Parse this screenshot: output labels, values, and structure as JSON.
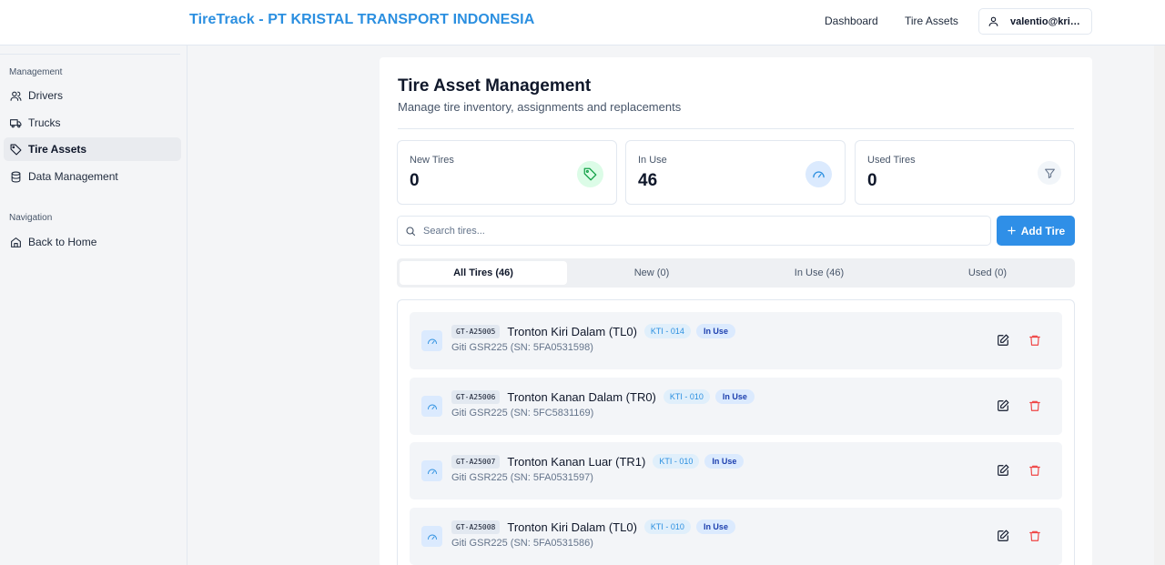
{
  "header": {
    "brand": "TireTrack - PT KRISTAL TRANSPORT INDONESIA",
    "nav": [
      "Dashboard",
      "Tire Assets"
    ],
    "user": "valentio@kris..."
  },
  "sidebar": {
    "management_title": "Management",
    "management_items": [
      "Drivers",
      "Trucks",
      "Tire Assets",
      "Data Management"
    ],
    "navigation_title": "Navigation",
    "navigation_items": [
      "Back to Home"
    ]
  },
  "page": {
    "title": "Tire Asset Management",
    "subtitle": "Manage tire inventory, assignments and replacements"
  },
  "stats": [
    {
      "label": "New Tires",
      "value": "0",
      "icon": "tag-icon",
      "color": "#16a34a"
    },
    {
      "label": "In Use",
      "value": "46",
      "icon": "gauge-icon",
      "color": "#2b8fe0"
    },
    {
      "label": "Used Tires",
      "value": "0",
      "icon": "filter-icon",
      "color": "#64748b"
    }
  ],
  "search": {
    "placeholder": "Search tires..."
  },
  "add_button": "Add Tire",
  "tabs": [
    "All Tires (46)",
    "New (0)",
    "In Use (46)",
    "Used (0)"
  ],
  "tires": [
    {
      "code": "GT-A25005",
      "position": "Tronton Kiri Dalam (TL0)",
      "truck": "KTI - 014",
      "status": "In Use",
      "detail": "Giti GSR225 (SN: 5FA0531598)"
    },
    {
      "code": "GT-A25006",
      "position": "Tronton Kanan Dalam (TR0)",
      "truck": "KTI - 010",
      "status": "In Use",
      "detail": "Giti GSR225 (SN: 5FC5831169)"
    },
    {
      "code": "GT-A25007",
      "position": "Tronton Kanan Luar (TR1)",
      "truck": "KTI - 010",
      "status": "In Use",
      "detail": "Giti GSR225 (SN: 5FA0531597)"
    },
    {
      "code": "GT-A25008",
      "position": "Tronton Kiri Dalam (TL0)",
      "truck": "KTI - 010",
      "status": "In Use",
      "detail": "Giti GSR225 (SN: 5FA0531586)"
    }
  ],
  "colors": {
    "accent": "#2b8fe0",
    "button": "#2f8fe7",
    "danger": "#ef4444"
  }
}
